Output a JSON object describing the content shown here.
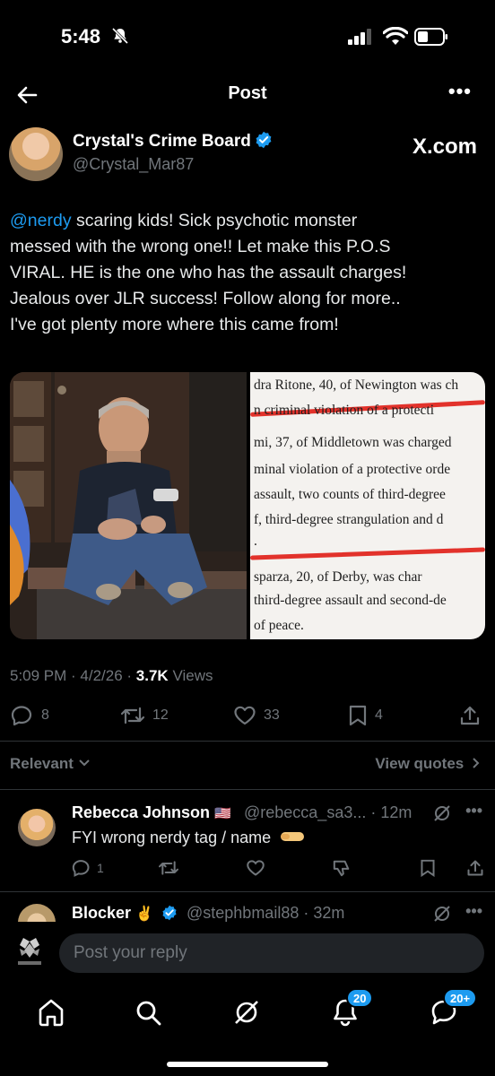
{
  "status_bar": {
    "time": "5:48"
  },
  "header": {
    "title": "Post",
    "more": "•••"
  },
  "author": {
    "name": "Crystal's Crime Board",
    "handle": "@Crystal_Mar87",
    "source": "X.com"
  },
  "tweet": {
    "mention": "@nerdy",
    "text": " scaring kids! Sick psychotic monster\nmessed with the wrong one!! Let make this P.O.S\nVIRAL. HE is the one who has the assault charges!\nJealous over JLR success! Follow along for more..\nI've got plenty more where this came from!",
    "document_lines": [
      "dra Ritone, 40, of Newington was ch",
      "n criminal violation of a protecti",
      "mi, 37, of Middletown was charged",
      "minal violation of a protective orde",
      "assault, two counts of third-degree",
      "f, third-degree strangulation and d",
      ".",
      "sparza, 20, of Derby, was char",
      "third-degree assault and second-de",
      "of peace."
    ],
    "time": "5:09 PM",
    "date": "4/2/26",
    "views_count": "3.7K",
    "views_label": "Views"
  },
  "actions": {
    "replies": "8",
    "reposts": "12",
    "likes": "33",
    "bookmarks": "4"
  },
  "filters": {
    "relevant": "Relevant",
    "view_quotes": "View quotes"
  },
  "replies": [
    {
      "name": "Rebecca Johnson",
      "flag": "🇺🇸",
      "handle_time": "@rebecca_sa3... · 12m",
      "text": "FYI wrong nerdy tag / name",
      "reply_count": "1"
    },
    {
      "name": "Blocker",
      "emoji": "✌️",
      "handle_time": "@stephbmail88 · 32m"
    }
  ],
  "composer": {
    "placeholder": "Post your reply"
  },
  "tabbar": {
    "notifications_badge": "20",
    "messages_badge": "20+"
  }
}
